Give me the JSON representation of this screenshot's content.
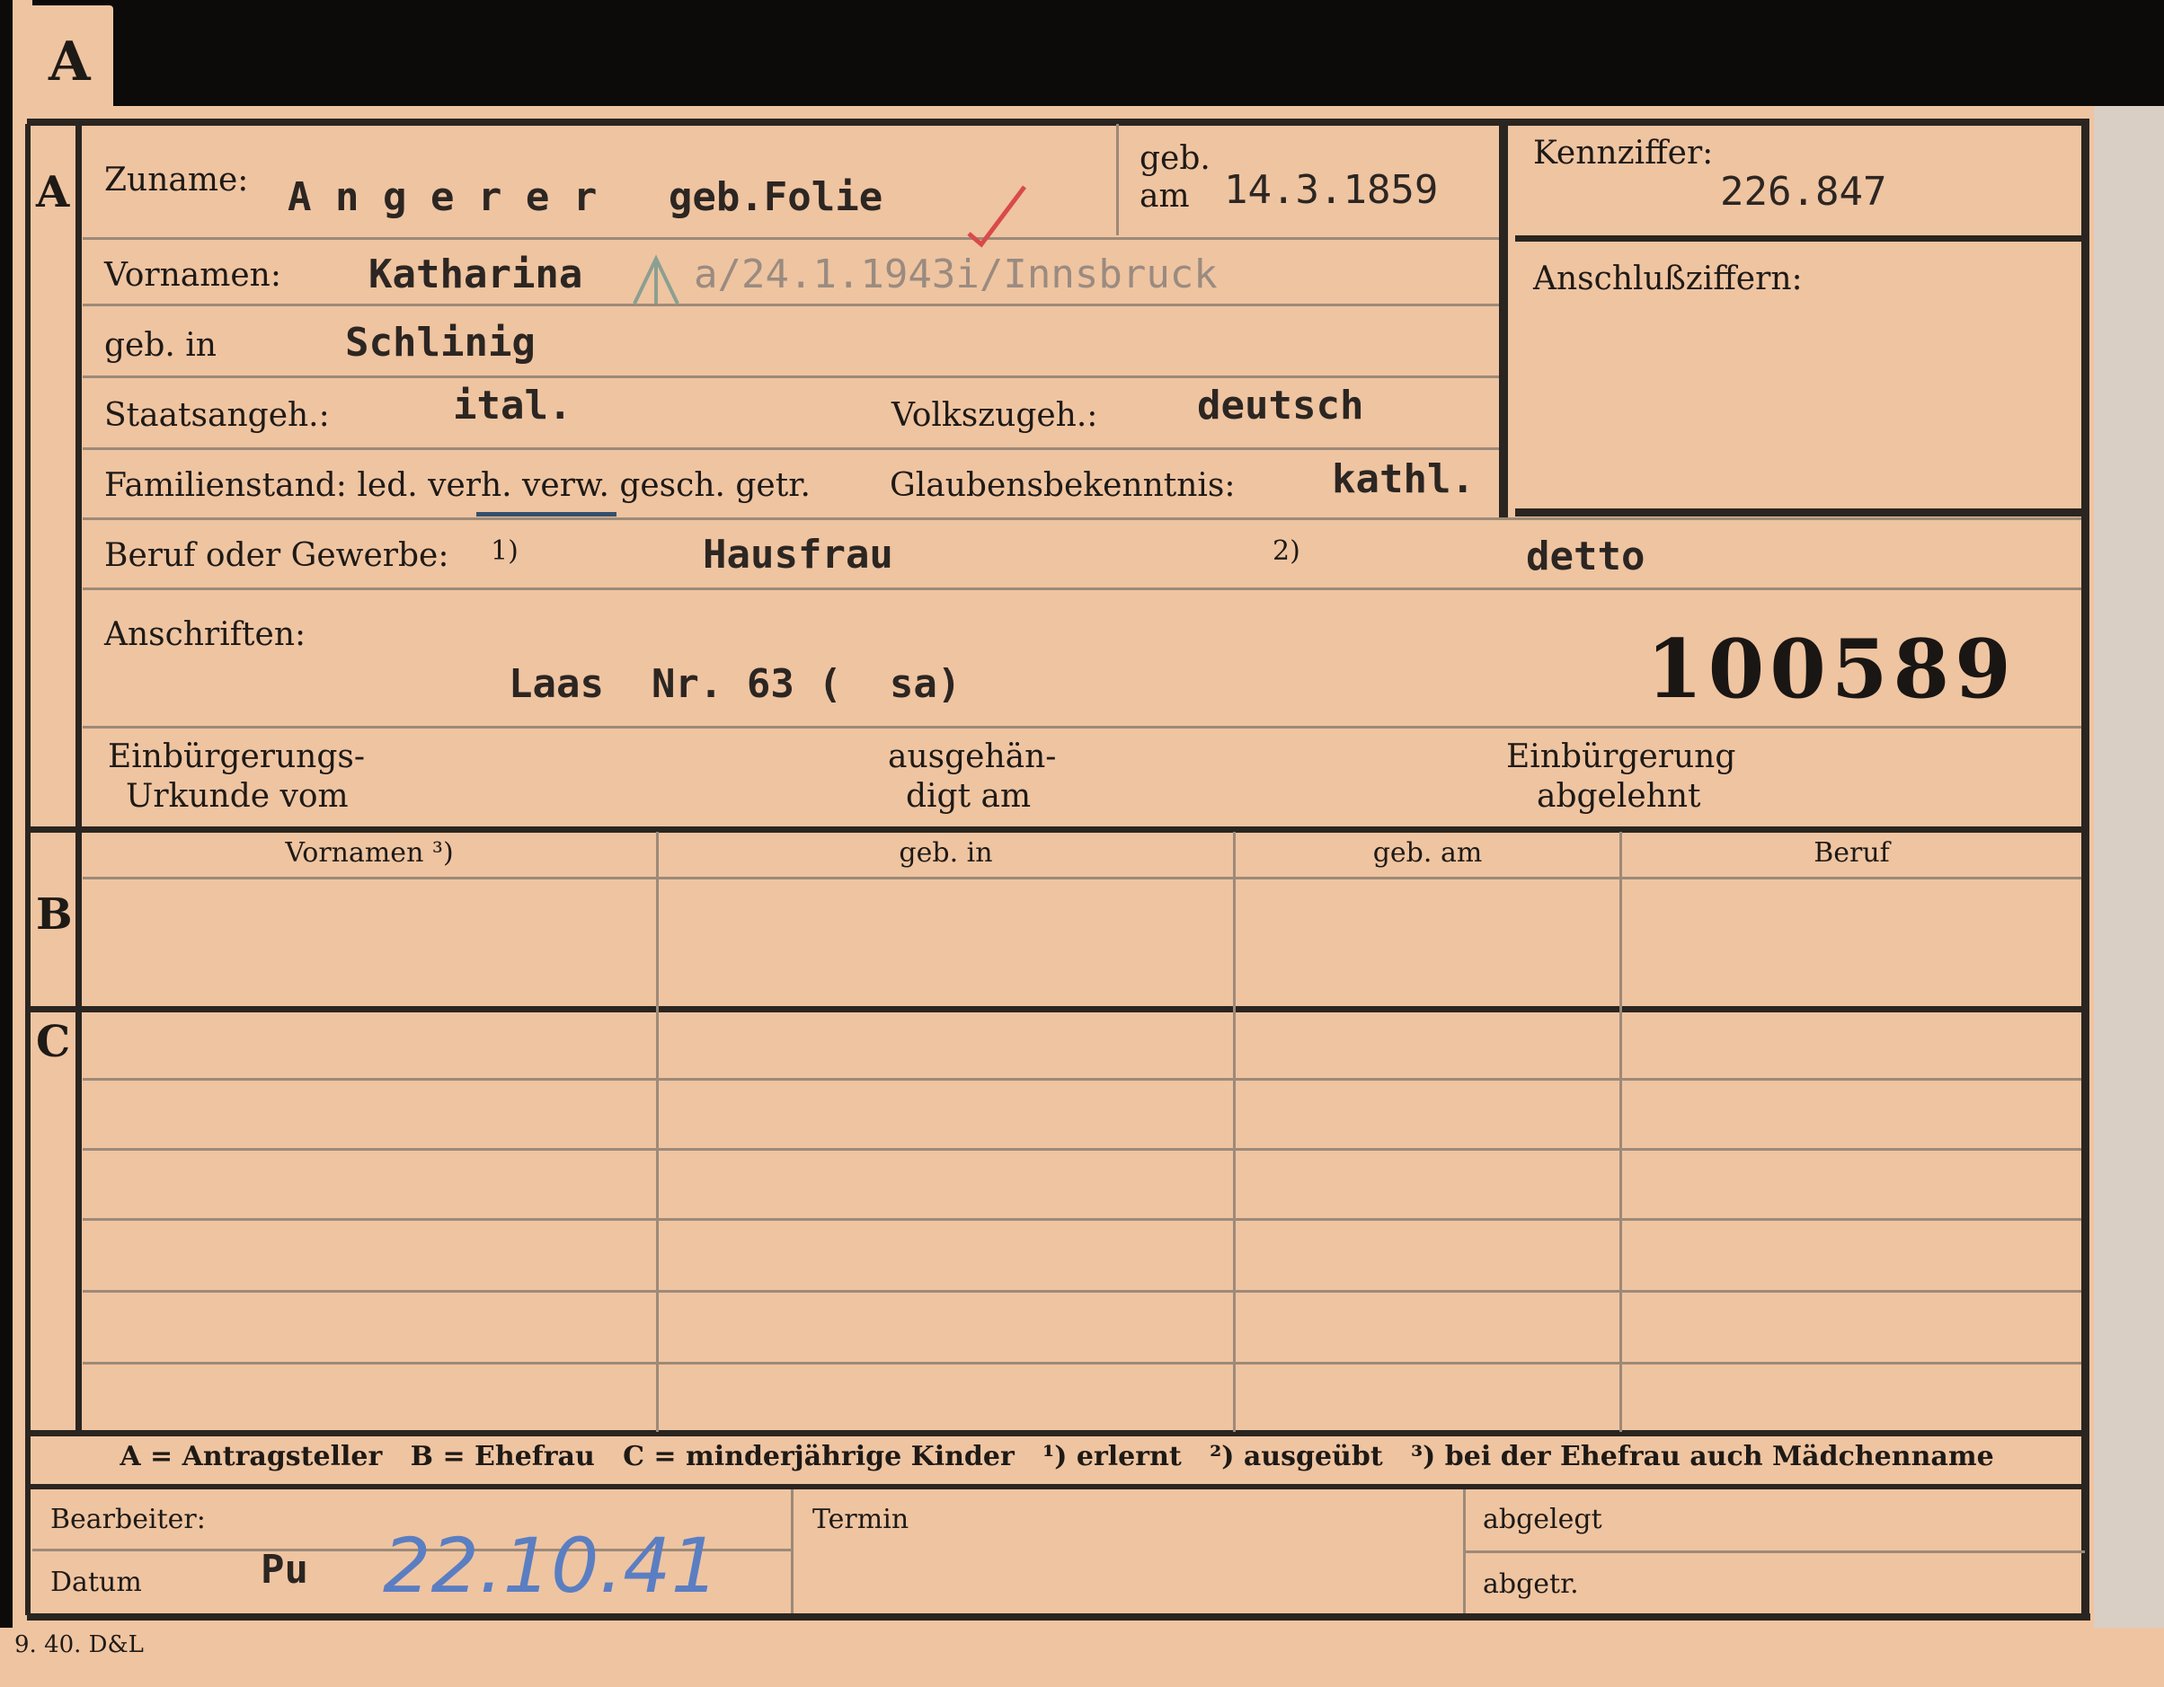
{
  "tab_letter": "A",
  "section_labels": {
    "a": "A",
    "b": "B",
    "c": "C"
  },
  "section_a": {
    "zuname_label": "Zuname:",
    "zuname_value": "A n g e r e r   geb.Folie",
    "geb_am_label_1": "geb.",
    "geb_am_label_2": "am",
    "geb_am_value": "14.3.1859",
    "kennziffer_label": "Kennziffer:",
    "kennziffer_value": "226.847",
    "anschlussziffern_label": "Anschlußziffern:",
    "vornamen_label": "Vornamen:",
    "vornamen_value": "Katharina",
    "vornamen_note": "a/24.1.1943i/Innsbruck",
    "geb_in_label": "geb. in",
    "geb_in_value": "Schlinig",
    "staatsangeh_label": "Staatsangeh.:",
    "staatsangeh_value": "ital.",
    "volkszugeh_label": "Volkszugeh.:",
    "volkszugeh_value": "deutsch",
    "familienstand_label": "Familienstand: led. verh. verw. gesch. getr.",
    "glaubensbekenntnis_label": "Glaubensbekenntnis:",
    "glaubensbekenntnis_value": "kathl.",
    "beruf_label": "Beruf oder Gewerbe:",
    "beruf_sup1": "1)",
    "beruf_value": "Hausfrau",
    "beruf_sup2": "2)",
    "beruf_value2": "detto",
    "anschriften_label": "Anschriften:",
    "anschriften_value": "Laas  Nr. 63 (  sa)",
    "big_number": "100589",
    "einbuergerung_urkunde_1": "Einbürgerungs-",
    "einbuergerung_urkunde_2": "Urkunde vom",
    "ausgehaendigt_1": "ausgehän-",
    "ausgehaendigt_2": "digt am",
    "einbuergerung_abgelehnt_1": "Einbürgerung",
    "einbuergerung_abgelehnt_2": "abgelehnt"
  },
  "table_headers": [
    "Vornamen ³)",
    "geb. in",
    "geb. am",
    "Beruf"
  ],
  "legend": "A = Antragsteller   B = Ehefrau   C = minderjährige Kinder   ¹) erlernt   ²) ausgeübt   ³) bei der Ehefrau auch Mädchenname",
  "footer": {
    "bearbeiter_label": "Bearbeiter:",
    "datum_label": "Datum",
    "initials": "Pu",
    "date_handwritten": "22.10.41",
    "termin_label": "Termin",
    "abgelegt_label": "abgelegt",
    "abgetr_label": "abgetr."
  },
  "print_mark": "9. 40. D&L",
  "colors": {
    "card": "#efc4a1",
    "ink": "#1e1a16",
    "blue_ink": "#5a7ec2",
    "red_check": "#d94a4a"
  }
}
